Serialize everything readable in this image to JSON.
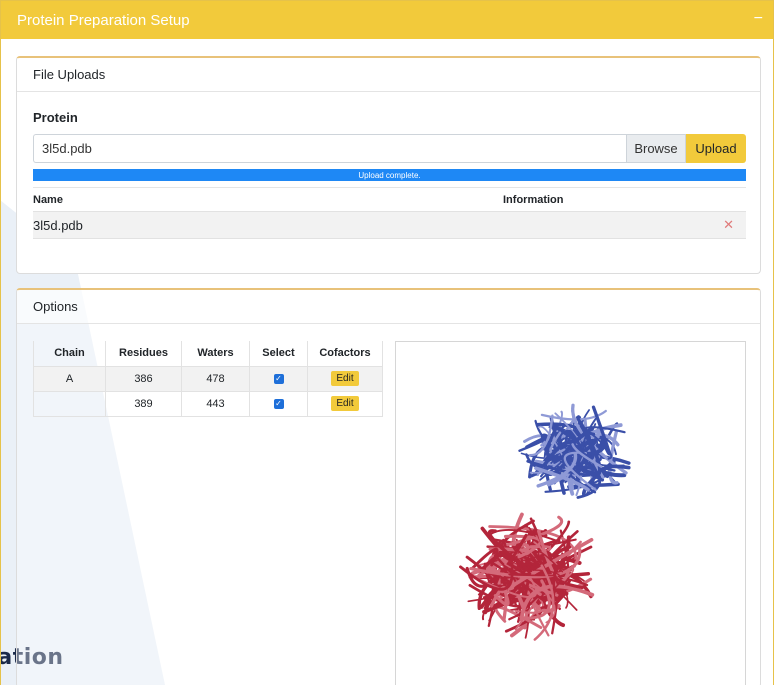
{
  "panel": {
    "title": "Protein Preparation Setup",
    "collapse_icon": "minus-icon"
  },
  "uploads": {
    "card_title": "File Uploads",
    "label": "Protein",
    "file_value": "3l5d.pdb",
    "browse_label": "Browse",
    "upload_label": "Upload",
    "progress_text": "Upload complete.",
    "progress_percent": 100,
    "table_headers": {
      "name": "Name",
      "information": "Information"
    },
    "files": [
      {
        "name": "3l5d.pdb",
        "information": ""
      }
    ]
  },
  "options": {
    "card_title": "Options",
    "headers": [
      "Chain",
      "Residues",
      "Waters",
      "Select",
      "Cofactors"
    ],
    "chains": [
      {
        "chain": "A",
        "residues": "386",
        "waters": "478",
        "selected": true,
        "cofactors_label": "Edit"
      },
      {
        "chain": "",
        "residues": "389",
        "waters": "443",
        "selected": true,
        "cofactors_label": "Edit"
      }
    ]
  },
  "background_text": "ration",
  "colors": {
    "accent": "#f2ca3b",
    "progress": "#1e88f5",
    "chain_a": "#3a4fa8",
    "chain_b": "#b3253a"
  }
}
